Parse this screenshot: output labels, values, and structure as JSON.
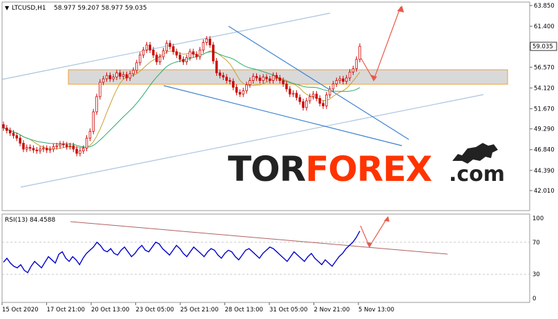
{
  "symbol_label": "LTCUSD,H1",
  "ohlc_label": "58.977 59.207 58.977 59.035",
  "rsi_label": "RSI(13) 84.4588",
  "brand": {
    "tor": "TOR",
    "forex": "FOREX",
    "com": ".com"
  },
  "colors": {
    "candles": "#cc0000",
    "ma_fast": "#c8a030",
    "ma_slow": "#2aaa6a",
    "channel": "#a9c4df",
    "wedge": "#3a7fd0",
    "zone_fill": "#d9d9d9",
    "zone_border": "#f0a030",
    "arrow": "#e85a4a",
    "rsi_line": "#0000cc",
    "rsi_trend": "#b06060",
    "price_tag_bg": "#ffffff",
    "brand_dark": "#222222",
    "brand_orange": "#ff3300"
  },
  "chart_data": [
    {
      "type": "candlestick",
      "title": "LTCUSD,H1",
      "y_ticks": [
        "63.850",
        "61.400",
        "58.950",
        "56.570",
        "54.120",
        "51.670",
        "49.290",
        "46.840",
        "44.390",
        "42.010"
      ],
      "ylim": [
        42.01,
        63.85
      ],
      "x_ticks": [
        "15 Oct 2020",
        "17 Oct 21:00",
        "20 Oct 13:00",
        "23 Oct 05:00",
        "25 Oct 21:00",
        "28 Oct 13:00",
        "31 Oct 05:00",
        "2 Nov 21:00",
        "5 Nov 13:00"
      ],
      "current_price": "59.035",
      "series": [
        {
          "name": "LTCUSD",
          "values": [
            [
              49.8,
              49.4
            ],
            [
              49.4,
              49.1
            ],
            [
              49.1,
              48.8
            ],
            [
              48.8,
              48.5
            ],
            [
              48.5,
              48.2
            ],
            [
              48.2,
              47.6
            ],
            [
              47.6,
              46.9
            ],
            [
              46.9,
              47.1
            ],
            [
              47.1,
              47.0
            ],
            [
              47.0,
              46.8
            ],
            [
              46.8,
              46.7
            ],
            [
              46.7,
              46.9
            ],
            [
              46.9,
              47.0
            ],
            [
              47.0,
              46.8
            ],
            [
              46.8,
              46.9
            ],
            [
              46.9,
              47.2
            ],
            [
              47.2,
              47.3
            ],
            [
              47.3,
              47.5
            ],
            [
              47.5,
              47.4
            ],
            [
              47.4,
              47.2
            ],
            [
              47.2,
              47.3
            ],
            [
              47.3,
              46.9
            ],
            [
              46.9,
              46.4
            ],
            [
              46.4,
              46.7
            ],
            [
              46.7,
              47.0
            ],
            [
              47.0,
              48.2
            ],
            [
              48.2,
              49.0
            ],
            [
              49.0,
              51.3
            ],
            [
              51.3,
              53.1
            ],
            [
              53.1,
              54.8
            ],
            [
              54.8,
              55.2
            ],
            [
              55.2,
              55.6
            ],
            [
              55.6,
              55.2
            ],
            [
              55.2,
              55.4
            ],
            [
              55.4,
              55.9
            ],
            [
              55.9,
              55.5
            ],
            [
              55.5,
              55.7
            ],
            [
              55.7,
              55.3
            ],
            [
              55.3,
              55.8
            ],
            [
              55.8,
              56.2
            ],
            [
              56.2,
              57.1
            ],
            [
              57.1,
              58.0
            ],
            [
              58.0,
              58.6
            ],
            [
              58.6,
              59.2
            ],
            [
              59.2,
              58.6
            ],
            [
              58.6,
              58.0
            ],
            [
              58.0,
              57.2
            ],
            [
              57.2,
              57.8
            ],
            [
              57.8,
              58.5
            ],
            [
              58.5,
              59.4
            ],
            [
              59.4,
              59.0
            ],
            [
              59.0,
              58.4
            ],
            [
              58.4,
              58.0
            ],
            [
              58.0,
              57.5
            ],
            [
              57.5,
              57.2
            ],
            [
              57.2,
              57.7
            ],
            [
              57.7,
              58.4
            ],
            [
              58.4,
              58.1
            ],
            [
              58.1,
              57.8
            ],
            [
              57.8,
              58.6
            ],
            [
              58.6,
              59.5
            ],
            [
              59.5,
              59.9
            ],
            [
              59.9,
              59.2
            ],
            [
              59.2,
              57.3
            ],
            [
              57.3,
              55.9
            ],
            [
              55.9,
              55.6
            ],
            [
              55.6,
              55.4
            ],
            [
              55.4,
              55.0
            ],
            [
              55.0,
              54.9
            ],
            [
              54.9,
              54.2
            ],
            [
              54.2,
              53.6
            ],
            [
              53.6,
              53.4
            ],
            [
              53.4,
              53.8
            ],
            [
              53.8,
              54.5
            ],
            [
              54.5,
              55.0
            ],
            [
              55.0,
              55.5
            ],
            [
              55.5,
              55.3
            ],
            [
              55.3,
              55.0
            ],
            [
              55.0,
              55.4
            ],
            [
              55.4,
              55.2
            ],
            [
              55.2,
              55.0
            ],
            [
              55.0,
              55.6
            ],
            [
              55.6,
              55.3
            ],
            [
              55.3,
              55.0
            ],
            [
              55.0,
              54.6
            ],
            [
              54.6,
              54.0
            ],
            [
              54.0,
              53.4
            ],
            [
              53.4,
              53.5
            ],
            [
              53.5,
              53.0
            ],
            [
              53.0,
              52.5
            ],
            [
              52.5,
              51.8
            ],
            [
              51.8,
              52.6
            ],
            [
              52.6,
              53.1
            ],
            [
              53.1,
              53.4
            ],
            [
              53.4,
              52.9
            ],
            [
              52.9,
              52.3
            ],
            [
              52.3,
              52.0
            ],
            [
              52.0,
              53.3
            ],
            [
              53.3,
              54.0
            ],
            [
              54.0,
              54.6
            ],
            [
              54.6,
              55.0
            ],
            [
              55.0,
              55.2
            ],
            [
              55.2,
              54.9
            ],
            [
              54.9,
              55.3
            ],
            [
              55.3,
              56.0
            ],
            [
              56.0,
              56.4
            ],
            [
              56.4,
              57.5
            ],
            [
              57.5,
              59.03
            ]
          ]
        }
      ]
    },
    {
      "type": "line",
      "title": "RSI(13) 84.4588",
      "y_ticks": [
        "100",
        "70",
        "30",
        "0"
      ],
      "ylim": [
        0,
        100
      ],
      "series": [
        {
          "name": "RSI(13)",
          "values": [
            45,
            50,
            44,
            40,
            38,
            42,
            35,
            32,
            40,
            46,
            42,
            38,
            45,
            52,
            48,
            44,
            55,
            58,
            50,
            46,
            52,
            48,
            42,
            50,
            56,
            60,
            64,
            70,
            66,
            60,
            58,
            62,
            56,
            54,
            60,
            64,
            58,
            52,
            56,
            62,
            66,
            60,
            58,
            64,
            70,
            68,
            62,
            58,
            54,
            60,
            66,
            62,
            56,
            52,
            58,
            64,
            60,
            56,
            52,
            58,
            62,
            60,
            54,
            50,
            56,
            60,
            58,
            52,
            48,
            54,
            60,
            62,
            58,
            54,
            50,
            56,
            60,
            64,
            62,
            58,
            54,
            50,
            46,
            52,
            58,
            54,
            50,
            46,
            52,
            56,
            50,
            46,
            42,
            48,
            44,
            40,
            46,
            52,
            56,
            62,
            66,
            70,
            76,
            84
          ]
        }
      ]
    }
  ]
}
